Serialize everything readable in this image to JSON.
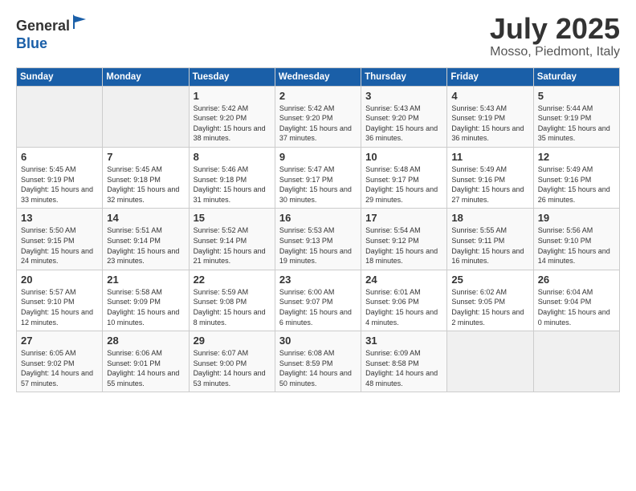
{
  "header": {
    "logo_line1": "General",
    "logo_line2": "Blue",
    "month": "July 2025",
    "location": "Mosso, Piedmont, Italy"
  },
  "weekdays": [
    "Sunday",
    "Monday",
    "Tuesday",
    "Wednesday",
    "Thursday",
    "Friday",
    "Saturday"
  ],
  "weeks": [
    [
      {
        "num": "",
        "info": ""
      },
      {
        "num": "",
        "info": ""
      },
      {
        "num": "1",
        "info": "Sunrise: 5:42 AM\nSunset: 9:20 PM\nDaylight: 15 hours and 38 minutes."
      },
      {
        "num": "2",
        "info": "Sunrise: 5:42 AM\nSunset: 9:20 PM\nDaylight: 15 hours and 37 minutes."
      },
      {
        "num": "3",
        "info": "Sunrise: 5:43 AM\nSunset: 9:20 PM\nDaylight: 15 hours and 36 minutes."
      },
      {
        "num": "4",
        "info": "Sunrise: 5:43 AM\nSunset: 9:19 PM\nDaylight: 15 hours and 36 minutes."
      },
      {
        "num": "5",
        "info": "Sunrise: 5:44 AM\nSunset: 9:19 PM\nDaylight: 15 hours and 35 minutes."
      }
    ],
    [
      {
        "num": "6",
        "info": "Sunrise: 5:45 AM\nSunset: 9:19 PM\nDaylight: 15 hours and 33 minutes."
      },
      {
        "num": "7",
        "info": "Sunrise: 5:45 AM\nSunset: 9:18 PM\nDaylight: 15 hours and 32 minutes."
      },
      {
        "num": "8",
        "info": "Sunrise: 5:46 AM\nSunset: 9:18 PM\nDaylight: 15 hours and 31 minutes."
      },
      {
        "num": "9",
        "info": "Sunrise: 5:47 AM\nSunset: 9:17 PM\nDaylight: 15 hours and 30 minutes."
      },
      {
        "num": "10",
        "info": "Sunrise: 5:48 AM\nSunset: 9:17 PM\nDaylight: 15 hours and 29 minutes."
      },
      {
        "num": "11",
        "info": "Sunrise: 5:49 AM\nSunset: 9:16 PM\nDaylight: 15 hours and 27 minutes."
      },
      {
        "num": "12",
        "info": "Sunrise: 5:49 AM\nSunset: 9:16 PM\nDaylight: 15 hours and 26 minutes."
      }
    ],
    [
      {
        "num": "13",
        "info": "Sunrise: 5:50 AM\nSunset: 9:15 PM\nDaylight: 15 hours and 24 minutes."
      },
      {
        "num": "14",
        "info": "Sunrise: 5:51 AM\nSunset: 9:14 PM\nDaylight: 15 hours and 23 minutes."
      },
      {
        "num": "15",
        "info": "Sunrise: 5:52 AM\nSunset: 9:14 PM\nDaylight: 15 hours and 21 minutes."
      },
      {
        "num": "16",
        "info": "Sunrise: 5:53 AM\nSunset: 9:13 PM\nDaylight: 15 hours and 19 minutes."
      },
      {
        "num": "17",
        "info": "Sunrise: 5:54 AM\nSunset: 9:12 PM\nDaylight: 15 hours and 18 minutes."
      },
      {
        "num": "18",
        "info": "Sunrise: 5:55 AM\nSunset: 9:11 PM\nDaylight: 15 hours and 16 minutes."
      },
      {
        "num": "19",
        "info": "Sunrise: 5:56 AM\nSunset: 9:10 PM\nDaylight: 15 hours and 14 minutes."
      }
    ],
    [
      {
        "num": "20",
        "info": "Sunrise: 5:57 AM\nSunset: 9:10 PM\nDaylight: 15 hours and 12 minutes."
      },
      {
        "num": "21",
        "info": "Sunrise: 5:58 AM\nSunset: 9:09 PM\nDaylight: 15 hours and 10 minutes."
      },
      {
        "num": "22",
        "info": "Sunrise: 5:59 AM\nSunset: 9:08 PM\nDaylight: 15 hours and 8 minutes."
      },
      {
        "num": "23",
        "info": "Sunrise: 6:00 AM\nSunset: 9:07 PM\nDaylight: 15 hours and 6 minutes."
      },
      {
        "num": "24",
        "info": "Sunrise: 6:01 AM\nSunset: 9:06 PM\nDaylight: 15 hours and 4 minutes."
      },
      {
        "num": "25",
        "info": "Sunrise: 6:02 AM\nSunset: 9:05 PM\nDaylight: 15 hours and 2 minutes."
      },
      {
        "num": "26",
        "info": "Sunrise: 6:04 AM\nSunset: 9:04 PM\nDaylight: 15 hours and 0 minutes."
      }
    ],
    [
      {
        "num": "27",
        "info": "Sunrise: 6:05 AM\nSunset: 9:02 PM\nDaylight: 14 hours and 57 minutes."
      },
      {
        "num": "28",
        "info": "Sunrise: 6:06 AM\nSunset: 9:01 PM\nDaylight: 14 hours and 55 minutes."
      },
      {
        "num": "29",
        "info": "Sunrise: 6:07 AM\nSunset: 9:00 PM\nDaylight: 14 hours and 53 minutes."
      },
      {
        "num": "30",
        "info": "Sunrise: 6:08 AM\nSunset: 8:59 PM\nDaylight: 14 hours and 50 minutes."
      },
      {
        "num": "31",
        "info": "Sunrise: 6:09 AM\nSunset: 8:58 PM\nDaylight: 14 hours and 48 minutes."
      },
      {
        "num": "",
        "info": ""
      },
      {
        "num": "",
        "info": ""
      }
    ]
  ]
}
